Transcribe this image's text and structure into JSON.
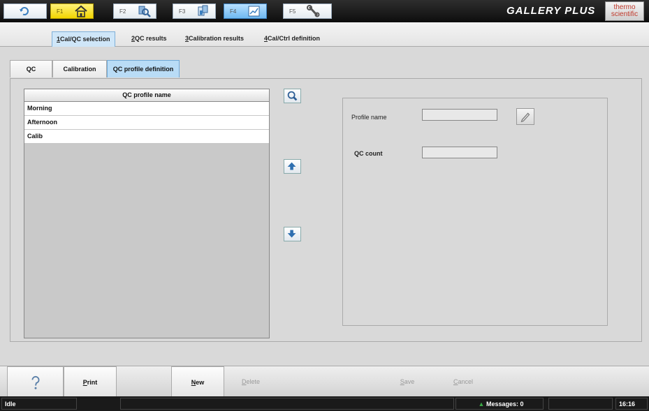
{
  "toolbar": {
    "fkeys": [
      {
        "label": "F1",
        "icon": "home-icon"
      },
      {
        "label": "F2",
        "icon": "sample-search-icon"
      },
      {
        "label": "F3",
        "icon": "test-tube-icon"
      },
      {
        "label": "F4",
        "icon": "chart-icon"
      },
      {
        "label": "F5",
        "icon": "wrench-icon"
      }
    ],
    "brand": "GALLERY PLUS",
    "logo_line1": "thermo",
    "logo_line2": "scientific"
  },
  "subtabs": [
    {
      "key": "1",
      "label": "Cal/QC selection"
    },
    {
      "key": "2",
      "label": "QC results"
    },
    {
      "key": "3",
      "label": "Calibration results"
    },
    {
      "key": "4",
      "label": "Cal/Ctrl definition"
    }
  ],
  "tabs": [
    "QC",
    "Calibration",
    "QC profile definition"
  ],
  "list": {
    "header": "QC profile name",
    "items": [
      "Morning",
      "Afternoon",
      "Calib"
    ]
  },
  "detail": {
    "profile_name_label": "Profile name",
    "profile_name_value": "",
    "qc_count_label": "QC count",
    "qc_count_value": ""
  },
  "buttons": {
    "help_icon": "help-icon",
    "print_key": "P",
    "print_rest": "rint",
    "new_key": "N",
    "new_rest": "ew",
    "delete_key": "D",
    "delete_rest": "elete",
    "save_key": "S",
    "save_rest": "ave",
    "cancel_key": "C",
    "cancel_rest": "ancel"
  },
  "status": {
    "state": "Idle",
    "messages": "Messages: 0",
    "time": "16:16"
  },
  "colors": {
    "active_fkey": "#f2d400",
    "selected_tab": "#b9dcf6",
    "brand_text": "#ffffff"
  }
}
